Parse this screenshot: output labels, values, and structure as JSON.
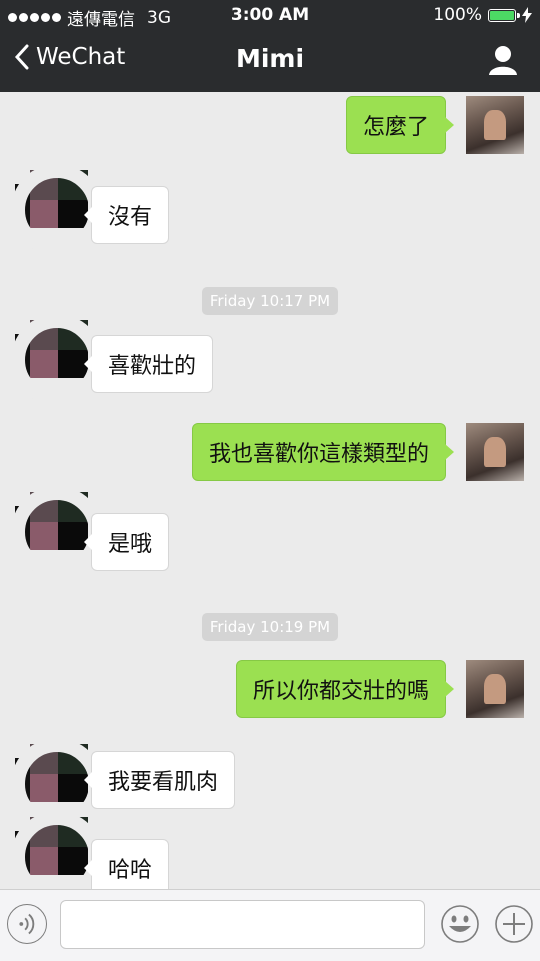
{
  "status_bar": {
    "carrier": "遠傳電信",
    "network": "3G",
    "time": "3:00 AM",
    "battery_percent": "100%",
    "battery_level": 1.0,
    "signal_bars": 5
  },
  "nav": {
    "back_label": "WeChat",
    "title": "Mimi"
  },
  "messages": [
    {
      "from": "me",
      "text": "怎麼了"
    },
    {
      "from": "contact",
      "text": "沒有"
    },
    {
      "type": "timestamp",
      "text": "Friday 10:17 PM"
    },
    {
      "from": "contact",
      "text": "喜歡壯的"
    },
    {
      "from": "me",
      "text": "我也喜歡你這樣類型的"
    },
    {
      "from": "contact",
      "text": "是哦"
    },
    {
      "type": "timestamp",
      "text": "Friday 10:19 PM"
    },
    {
      "from": "me",
      "text": "所以你都交壯的嗎"
    },
    {
      "from": "contact",
      "text": "我要看肌肉"
    },
    {
      "from": "contact",
      "text": "哈哈"
    }
  ],
  "input_bar": {
    "value": "",
    "placeholder": ""
  },
  "colors": {
    "bar_background": "#2a2c2e",
    "chat_background": "#ebebeb",
    "outgoing_bubble": "#9be051",
    "incoming_bubble": "#ffffff",
    "timestamp_pill": "#d4d4d4",
    "battery_fill": "#4cd964"
  },
  "icons": {
    "back": "chevron-left-icon",
    "profile": "person-icon",
    "voice": "voice-icon",
    "emoji": "smiley-icon",
    "more": "plus-icon"
  }
}
